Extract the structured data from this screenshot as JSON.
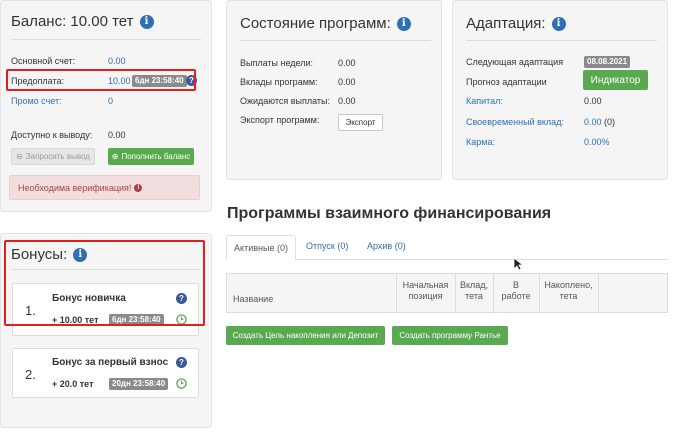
{
  "balance": {
    "title": "Баланс: 10.00 тет",
    "main_account_label": "Основной счет:",
    "main_account_value": "0.00",
    "prepayment_label": "Предоплата:",
    "prepayment_value": "10.00",
    "prepayment_timer": "6дн 23:58:40",
    "promo_label": "Промо счет:",
    "promo_value": "0",
    "available_label": "Доступно к выводу:",
    "available_value": "0.00",
    "withdraw_button": "Запросить вывод",
    "topup_button": "Пополнить баланс",
    "verification_text": "Необходима верификация!"
  },
  "programs_state": {
    "title": "Состояние программ:",
    "rows": [
      {
        "label": "Выплаты недели:",
        "value": "0.00"
      },
      {
        "label": "Вклады программ:",
        "value": "0.00"
      },
      {
        "label": "Ожидаются выплаты:",
        "value": "0.00"
      }
    ],
    "export_label": "Экспорт программ:",
    "export_button": "Экспорт"
  },
  "adaptation": {
    "title": "Адаптация:",
    "next_label": "Следующая адаптация",
    "next_value": "08.08.2021",
    "forecast_label": "Прогноз адаптации",
    "indicator_button": "Индикатор",
    "capital_label": "Капитал:",
    "capital_value": "0.00",
    "timely_label": "Своевременный вклад:",
    "timely_value": "0.00",
    "timely_count": "(0)",
    "karma_label": "Карма:",
    "karma_value": "0.00%"
  },
  "bonuses": {
    "title": "Бонусы:",
    "items": [
      {
        "num": "1.",
        "title": "Бонус новичка",
        "amount": "+ 10.00 тет",
        "timer": "6дн 23:58:40"
      },
      {
        "num": "2.",
        "title": "Бонус за первый взнос",
        "amount": "+ 20.0 тет",
        "timer": "20дн 23:58:40"
      }
    ]
  },
  "mutual": {
    "title": "Программы взаимного финансирования",
    "tabs": [
      {
        "label": "Активные (0)"
      },
      {
        "label": "Отпуск (0)"
      },
      {
        "label": "Архив (0)"
      }
    ],
    "columns": {
      "name": "Название",
      "start_line1": "Начальная",
      "start_line2": "позиция",
      "deposit_line1": "Вклад,",
      "deposit_line2": "тета",
      "work_line1": "В",
      "work_line2": "работе",
      "saved_line1": "Накоплено,",
      "saved_line2": "тета"
    },
    "create_goal_button": "Создать Цель накопления или Депозит",
    "create_rentier_button": "Создать программу Рантье"
  },
  "colors": {
    "accent_blue": "#2f6fb5",
    "green": "#5aa84f",
    "highlight_red": "#e41e1e"
  }
}
